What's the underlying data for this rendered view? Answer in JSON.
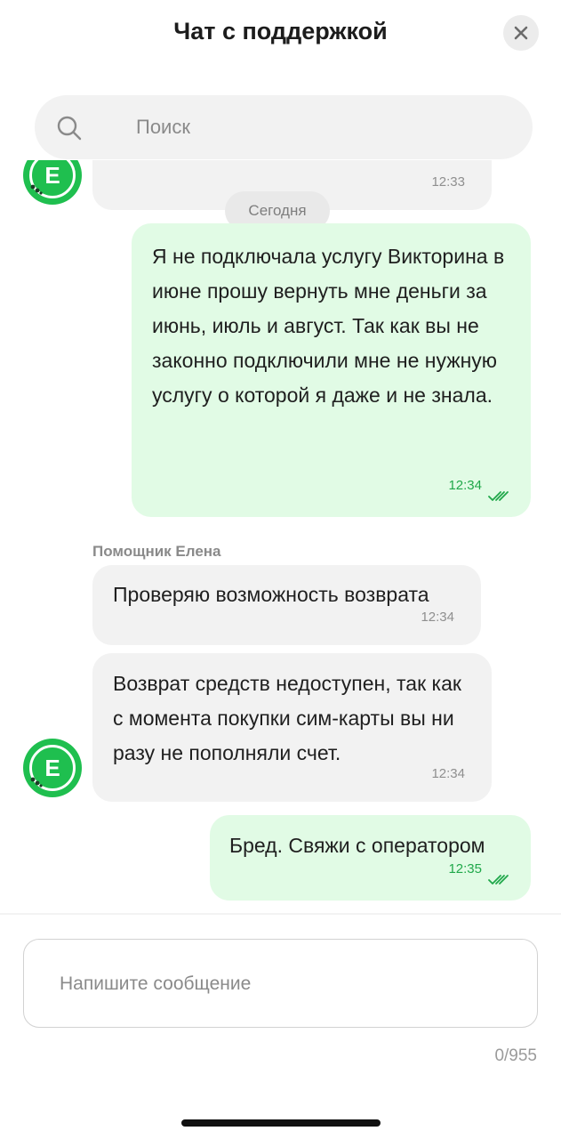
{
  "header": {
    "title": "Чат с поддержкой",
    "close_icon": "close-icon"
  },
  "search": {
    "placeholder": "Поиск",
    "icon": "search-icon"
  },
  "chat": {
    "partial_message_time": "12:33",
    "date_divider": "Сегодня",
    "messages": [
      {
        "direction": "outgoing",
        "text": "Я не подключала услугу Викторина в июне прошу вернуть мне деньги за июнь, июль и август. Так как вы не законно подключили мне не нужную услугу о которой я даже и не знала.",
        "time": "12:34",
        "status_icon": "double-check-icon"
      },
      {
        "direction": "incoming",
        "sender": "Помощник Елена",
        "text": "Проверяю возможность возврата",
        "time": "12:34"
      },
      {
        "direction": "incoming",
        "text": "Возврат средств недоступен, так как с момента покупки сим-карты вы ни разу не пополняли счет.",
        "time": "12:34"
      },
      {
        "direction": "outgoing",
        "text": "Бред. Свяжи с оператором",
        "time": "12:35",
        "status_icon": "double-check-icon"
      }
    ],
    "avatar_letter": "E"
  },
  "composer": {
    "placeholder": "Напишите сообщение",
    "counter": "0/955"
  },
  "colors": {
    "outgoing_bubble": "#e1fbe5",
    "incoming_bubble": "#f2f2f2",
    "accent_green": "#1fbf4f",
    "time_green": "#20a84a"
  }
}
